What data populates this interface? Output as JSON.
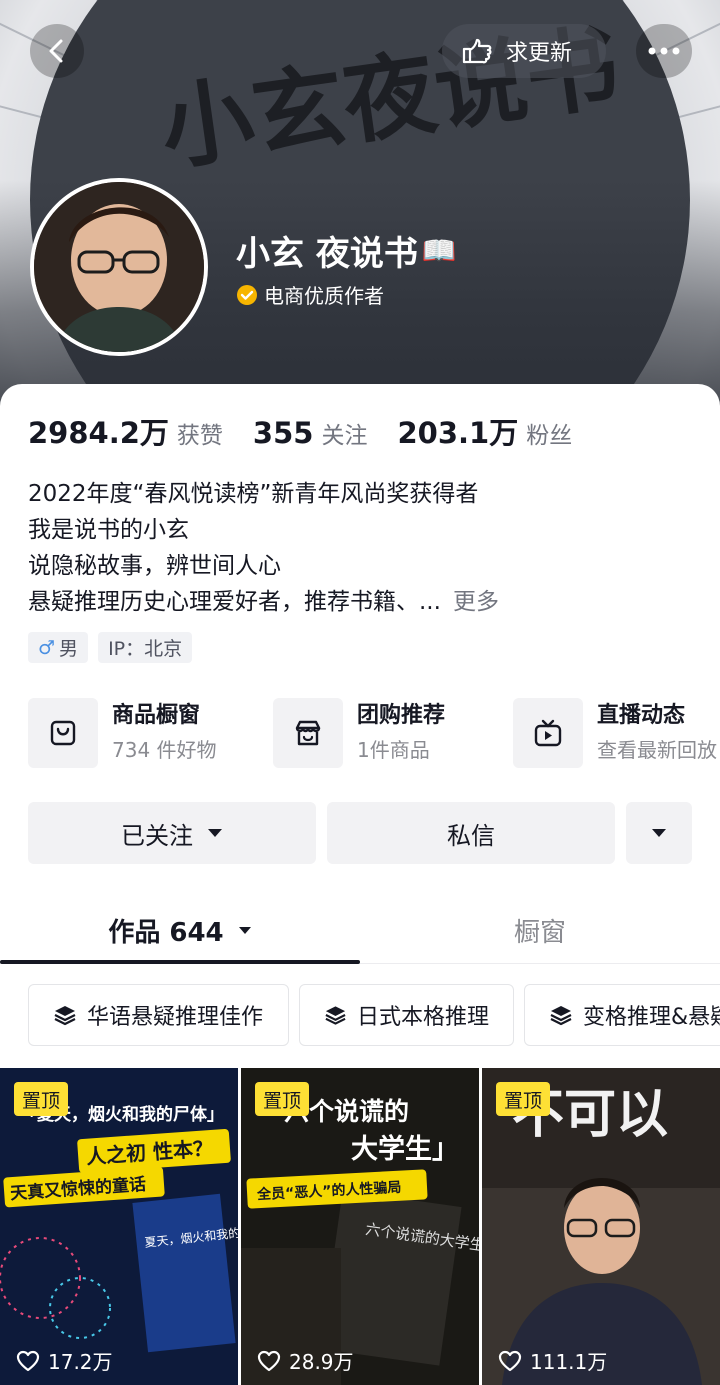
{
  "header": {
    "fan_title": "小玄夜说书",
    "request_label": "求更新",
    "nickname": "小玄 夜说书",
    "nickname_emoji": "📖",
    "verify_label": "电商优质作者",
    "colors": {
      "verify": "#f7b500"
    }
  },
  "stats": [
    {
      "value": "2984.2万",
      "label": "获赞"
    },
    {
      "value": "355",
      "label": "关注"
    },
    {
      "value": "203.1万",
      "label": "粉丝"
    }
  ],
  "bio": {
    "lines": [
      "2022年度“春风悦读榜”新青年风尚奖获得者",
      "我是说书的小玄",
      "说隐秘故事，辨世间人心",
      "悬疑推理历史心理爱好者，推荐书籍、..."
    ],
    "more_label": "更多"
  },
  "tags": {
    "gender_symbol": "♂",
    "gender": "男",
    "ip": "IP：北京"
  },
  "services": [
    {
      "title": "商品橱窗",
      "subtitle": "734 件好物",
      "icon": "bag-icon"
    },
    {
      "title": "团购推荐",
      "subtitle": "1件商品",
      "icon": "store-icon"
    },
    {
      "title": "直播动态",
      "subtitle": "查看最新回放",
      "icon": "tv-icon"
    }
  ],
  "actions": {
    "follow_label": "已关注",
    "message_label": "私信"
  },
  "tabs": {
    "works_label": "作品 644",
    "window_label": "橱窗"
  },
  "collections": [
    "华语悬疑推理佳作",
    "日式本格推理",
    "变格推理&悬疑"
  ],
  "videos": [
    {
      "pin_label": "置顶",
      "likes": "17.2万",
      "cover": {
        "line1": "「夏天，烟火和我的尸体」",
        "line2": "人之初 性本？",
        "line3": "天真又惊悚的童话",
        "book": "夏天，烟火和我的尸体"
      }
    },
    {
      "pin_label": "置顶",
      "likes": "28.9万",
      "cover": {
        "line1": "「六个说谎的",
        "line2": "大学生」",
        "line3": "全员“恶人”的人性骗局",
        "book": "六个说谎的大学生"
      }
    },
    {
      "pin_label": "置顶",
      "likes": "111.1万",
      "cover": {
        "line1": "不可以"
      }
    }
  ]
}
